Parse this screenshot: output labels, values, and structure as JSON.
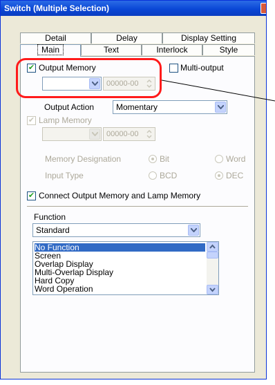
{
  "window": {
    "title": "Switch (Multiple Selection)"
  },
  "tabs": {
    "back": [
      "Detail",
      "Delay",
      "Display Setting"
    ],
    "front": [
      "Main",
      "Text",
      "Interlock",
      "Style"
    ],
    "active": "Main"
  },
  "output_memory": {
    "label": "Output Memory",
    "checked": true,
    "address": "00000-00"
  },
  "multi_output": {
    "label": "Multi-output",
    "checked": false
  },
  "output_action": {
    "label": "Output Action",
    "value": "Momentary"
  },
  "lamp_memory": {
    "label": "Lamp Memory",
    "checked": true,
    "disabled": true,
    "address": "00000-00"
  },
  "memory_designation": {
    "label": "Memory Designation",
    "options": [
      "Bit",
      "Word"
    ],
    "selected": "Bit"
  },
  "input_type": {
    "label": "Input Type",
    "options": [
      "BCD",
      "DEC"
    ],
    "selected": "DEC"
  },
  "connect": {
    "label": "Connect Output Memory and Lamp Memory",
    "checked": true
  },
  "function": {
    "label": "Function",
    "value": "Standard",
    "items": [
      "No Function",
      "Screen",
      "Overlap Display",
      "Multi-Overlap Display",
      "Hard Copy",
      "Word Operation"
    ],
    "selected_index": 0
  },
  "colors": {
    "highlight": "#ff1a1a",
    "selection": "#316ac5",
    "title_bar": "#0a47d6",
    "check": "#21a121"
  }
}
